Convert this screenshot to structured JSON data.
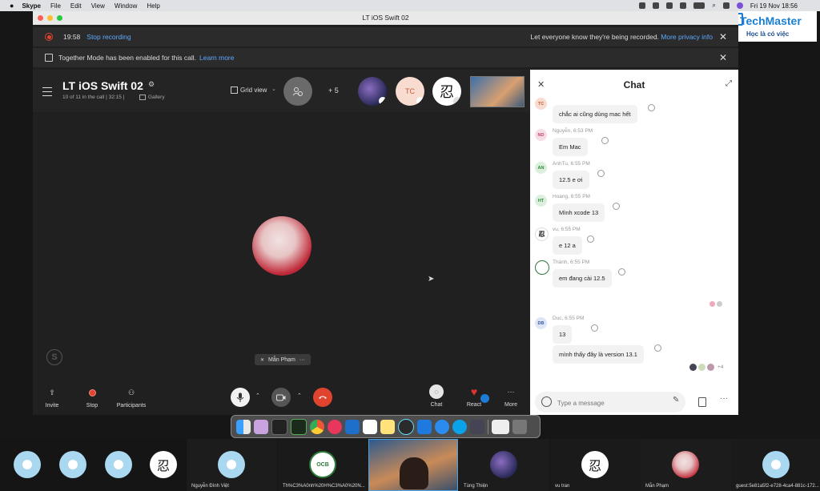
{
  "menubar": {
    "app": "Skype",
    "items": [
      "File",
      "Edit",
      "View",
      "Window",
      "Help"
    ],
    "clock": "Fri 19 Nov  18:56"
  },
  "window": {
    "title": "LT iOS Swift 02"
  },
  "recording_banner": {
    "time": "19:58",
    "stop_label": "Stop recording",
    "notice": "Let everyone know they're being recorded.",
    "more_info": "More privacy info"
  },
  "together_banner": {
    "text": "Together Mode has been enabled for this call.",
    "learn_more": "Learn more"
  },
  "call": {
    "title": "LT iOS Swift 02",
    "subtitle": "10 of 11 in the call | 32:15 |",
    "gallery": "Gallery",
    "grid_view": "Grid view",
    "more_count": "+ 5",
    "tc_initials": "TC",
    "active_speaker": "Mẫn Phạm",
    "active_speaker_more": "···"
  },
  "controls": {
    "invite": "Invite",
    "stop": "Stop",
    "participants": "Participants",
    "chat": "Chat",
    "react": "React",
    "more": "More"
  },
  "chat": {
    "title": "Chat",
    "placeholder": "Type a message",
    "messages": [
      {
        "initials": "TC",
        "meta": "",
        "text": "chắc ai cũng dùng mac hết"
      },
      {
        "initials": "ND",
        "meta": "Nguyễn, 6:53 PM",
        "text": "Em Mac"
      },
      {
        "initials": "AN",
        "meta": "AnhTu, 6:55 PM",
        "text": "12.5 e ơi"
      },
      {
        "initials": "HT",
        "meta": "Hoang, 6:55 PM",
        "text": "Mình xcode 13"
      },
      {
        "initials": "",
        "meta": "vu, 6:55 PM",
        "text": "e 12 a"
      },
      {
        "initials": "",
        "meta": "Thành, 6:55 PM",
        "text": "em đang cài 12.5"
      },
      {
        "initials": "DB",
        "meta": "Duc, 6:55 PM",
        "text": "13"
      },
      {
        "initials": "",
        "meta": "",
        "text": "mình thấy đây là version 13.1"
      }
    ],
    "seen_more": "+4"
  },
  "strip": {
    "names": [
      "Nguyễn Đình Việt",
      "Th%C3%A0nh%20H%C3%A0%20N...",
      "Tùng Thiện",
      "vu tran",
      "Mẫn Phạm",
      "guest:5e81a5f2-e728-4ca4-881c-172..."
    ]
  },
  "watermark": {
    "brand": "TechMaster",
    "tagline": "Học là có việc"
  },
  "colors": {
    "accent": "#5ea8ff",
    "end_call": "#e0442f",
    "chat_bg": "#ffffff",
    "stage_bg": "#202020"
  }
}
